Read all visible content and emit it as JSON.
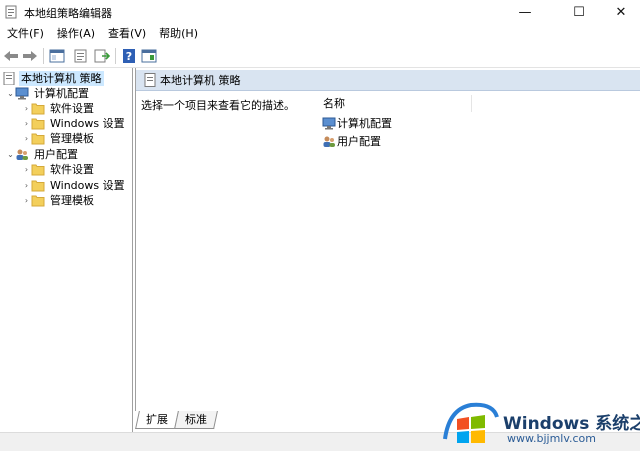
{
  "window": {
    "title": "本地组策略编辑器",
    "min_glyph": "—",
    "max_glyph": "☐",
    "close_glyph": "✕"
  },
  "menu": [
    "文件(F)",
    "操作(A)",
    "查看(V)",
    "帮助(H)"
  ],
  "toolbar": {
    "icons": [
      "back-icon",
      "forward-icon",
      "show-hide-tree-icon",
      "properties-icon",
      "export-list-icon",
      "help-icon",
      "show-hide-action-pane-icon"
    ]
  },
  "tree": {
    "root": "本地计算机 策略",
    "computer": {
      "label": "计算机配置",
      "children": [
        "软件设置",
        "Windows 设置",
        "管理模板"
      ]
    },
    "user": {
      "label": "用户配置",
      "children": [
        "软件设置",
        "Windows 设置",
        "管理模板"
      ]
    }
  },
  "right": {
    "header_title": "本地计算机 策略",
    "hint": "选择一个项目来查看它的描述。",
    "column_name": "名称",
    "items": [
      "计算机配置",
      "用户配置"
    ]
  },
  "tabs": [
    "扩展",
    "标准"
  ],
  "watermark": {
    "main": "Windows 系统之家",
    "sub": "www.bjjmlv.com"
  },
  "colors": {
    "header_bg": "#d9e4f1",
    "selection_bg": "#cce8ff",
    "folder_yellow": "#f3cf5b"
  }
}
